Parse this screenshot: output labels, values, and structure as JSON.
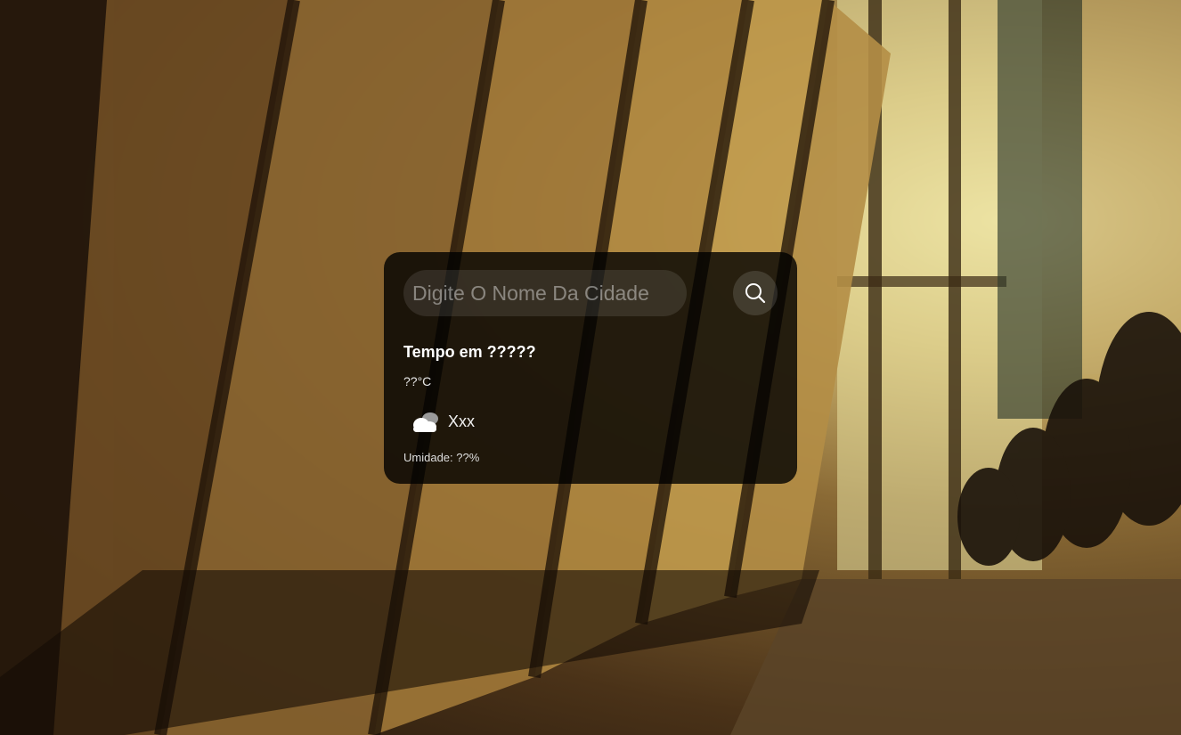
{
  "search": {
    "placeholder": "Digite O Nome Da Cidade",
    "icon": "search-icon"
  },
  "weather": {
    "title": "Tempo em ?????",
    "temperature": "??°C",
    "condition_icon": "cloud-icon",
    "condition_text": "Xxx",
    "humidity": "Umidade: ??%"
  },
  "colors": {
    "card_background": "#000000",
    "text": "#ffffff",
    "backdrop_warm": "#cdb46e",
    "backdrop_dark": "#1e130a"
  }
}
